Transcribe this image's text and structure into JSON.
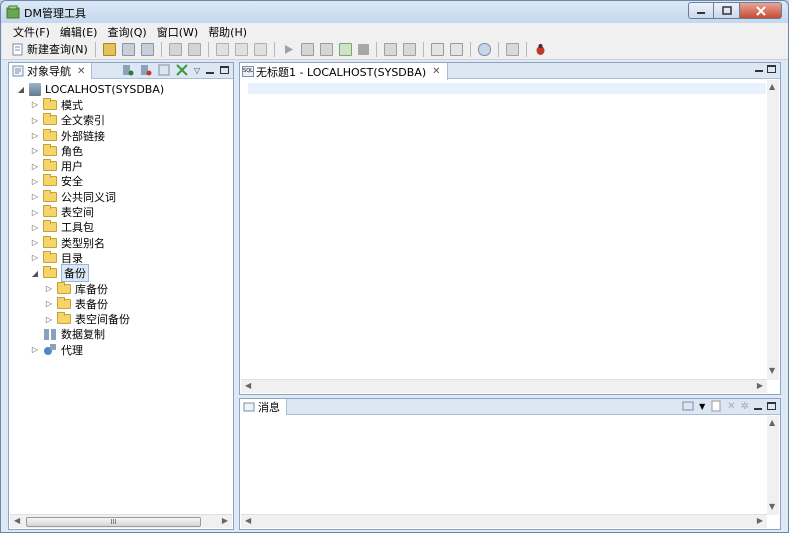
{
  "window": {
    "title": "DM管理工具"
  },
  "menu": [
    "文件(F)",
    "编辑(E)",
    "查询(Q)",
    "窗口(W)",
    "帮助(H)"
  ],
  "toolbar": {
    "new_query_label": "新建查询(N)",
    "buttons": [
      "open-icon",
      "save-icon",
      "save-all-icon",
      "undo-icon",
      "redo-icon",
      "cut-icon",
      "copy-icon",
      "paste-icon",
      "execute-icon",
      "execute-plan-icon",
      "explain-icon",
      "execute-script-icon",
      "stop-icon",
      "comment-icon",
      "uncomment-icon",
      "format-icon",
      "result-grid-icon",
      "connect-icon",
      "transaction-icon",
      "debug-icon"
    ]
  },
  "object_nav": {
    "tab_label": "对象导航",
    "root": "LOCALHOST(SYSDBA)",
    "items": [
      {
        "label": "模式",
        "type": "folder",
        "expanded": false
      },
      {
        "label": "全文索引",
        "type": "folder",
        "expanded": false
      },
      {
        "label": "外部链接",
        "type": "folder",
        "expanded": false
      },
      {
        "label": "角色",
        "type": "folder",
        "expanded": false
      },
      {
        "label": "用户",
        "type": "folder",
        "expanded": false
      },
      {
        "label": "安全",
        "type": "folder",
        "expanded": false
      },
      {
        "label": "公共同义词",
        "type": "folder",
        "expanded": false
      },
      {
        "label": "表空间",
        "type": "folder",
        "expanded": false
      },
      {
        "label": "工具包",
        "type": "folder",
        "expanded": false
      },
      {
        "label": "类型别名",
        "type": "folder",
        "expanded": false
      },
      {
        "label": "目录",
        "type": "folder",
        "expanded": false
      },
      {
        "label": "备份",
        "type": "folder",
        "expanded": true,
        "selected": true
      },
      {
        "label": "数据复制",
        "type": "replication",
        "expanded": false
      },
      {
        "label": "代理",
        "type": "agent",
        "expanded": false
      }
    ],
    "backup_children": [
      "库备份",
      "表备份",
      "表空间备份"
    ],
    "scroll_thumb_label": "III"
  },
  "editor": {
    "tab_label": "无标题1 - LOCALHOST(SYSDBA)"
  },
  "messages": {
    "tab_label": "消息"
  },
  "colors": {
    "accent": "#dbe8f7",
    "frame": "#8ea4c2",
    "folder": "#f5d56a"
  }
}
